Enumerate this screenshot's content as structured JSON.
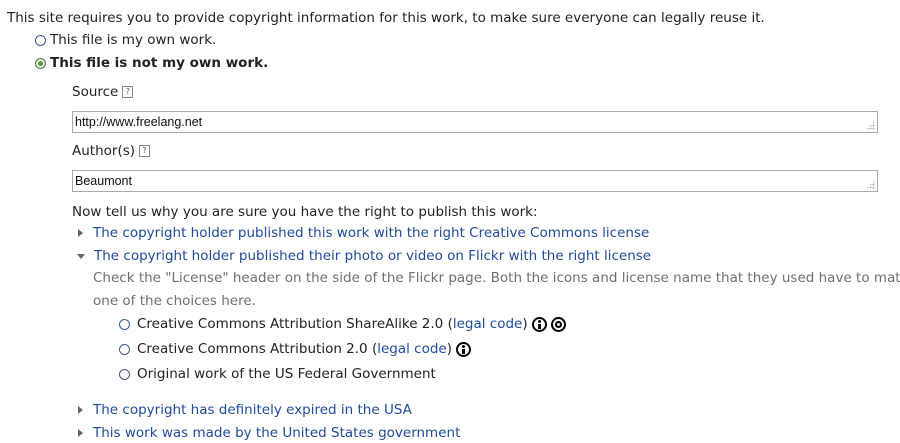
{
  "intro_text": "This site requires you to provide copyright information for this work, to make sure everyone can legally reuse it.",
  "ownership": {
    "own_work_label": "This file is my own work.",
    "not_own_work_label": "This file is not my own work.",
    "selected": "not_own_work"
  },
  "source": {
    "label": "Source",
    "help_icon": "?",
    "value": "http://www.freelang.net"
  },
  "authors": {
    "label": "Author(s)",
    "help_icon": "?",
    "value": "Beaumont"
  },
  "rights": {
    "prompt": "Now tell us why you are sure you have the right to publish this work:",
    "options": [
      {
        "label": "The copyright holder published this work with the right Creative Commons license",
        "expanded": false
      },
      {
        "label": "The copyright holder published their photo or video on Flickr with the right license",
        "expanded": true
      },
      {
        "label": "The copyright has definitely expired in the USA",
        "expanded": false
      },
      {
        "label": "This work was made by the United States government",
        "expanded": false
      }
    ],
    "flickr_hint_line1": "Check the \"License\" header on the side of the Flickr page. Both the icons and license name that they used have to match",
    "flickr_hint_line2": "one of the choices here.",
    "licenses": [
      {
        "label": "Creative Commons Attribution ShareAlike 2.0 (",
        "link": "legal code",
        "suffix": ")",
        "icons": [
          "cc-by-icon",
          "cc-sa-icon"
        ]
      },
      {
        "label": "Creative Commons Attribution 2.0 (",
        "link": "legal code",
        "suffix": ")",
        "icons": [
          "cc-by-icon"
        ]
      },
      {
        "label": "Original work of the US Federal Government",
        "link": "",
        "suffix": "",
        "icons": []
      }
    ]
  },
  "colors": {
    "link": "#1f4a9e",
    "hint": "#6f6f6f",
    "radio_checked": "#5b9a3f"
  }
}
